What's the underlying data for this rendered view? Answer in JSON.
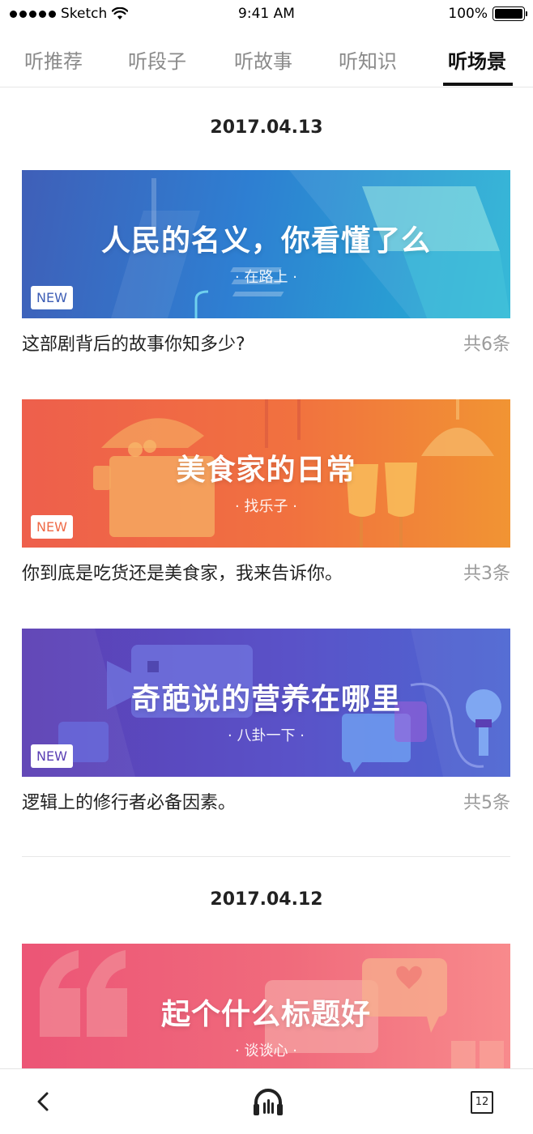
{
  "status_bar": {
    "carrier": "Sketch",
    "time": "9:41 AM",
    "battery": "100%"
  },
  "tabs": [
    {
      "label": "听推荐",
      "active": false
    },
    {
      "label": "听段子",
      "active": false
    },
    {
      "label": "听故事",
      "active": false
    },
    {
      "label": "听知识",
      "active": false
    },
    {
      "label": "听场景",
      "active": true
    }
  ],
  "sections": [
    {
      "date": "2017.04.13",
      "items": [
        {
          "title": "人民的名义，你看懂了么",
          "tag": "· 在路上 ·",
          "badge": "NEW",
          "badge_color": "#3d5db5",
          "description": "这部剧背后的故事你知多少?",
          "count": "共6条"
        },
        {
          "title": "美食家的日常",
          "tag": "· 找乐子 ·",
          "badge": "NEW",
          "badge_color": "#ef6a47",
          "description": "你到底是吃货还是美食家，我来告诉你。",
          "count": "共3条"
        },
        {
          "title": "奇葩说的营养在哪里",
          "tag": "· 八卦一下 ·",
          "badge": "NEW",
          "badge_color": "#5a3fb4",
          "description": "逻辑上的修行者必备因素。",
          "count": "共5条"
        }
      ]
    },
    {
      "date": "2017.04.12",
      "items": [
        {
          "title": "起个什么标题好",
          "tag": "· 谈谈心 ·"
        }
      ]
    }
  ],
  "bottom_bar": {
    "back_icon": "chevron-left-icon",
    "player_icon": "headphones-icon",
    "list_count": "12"
  }
}
